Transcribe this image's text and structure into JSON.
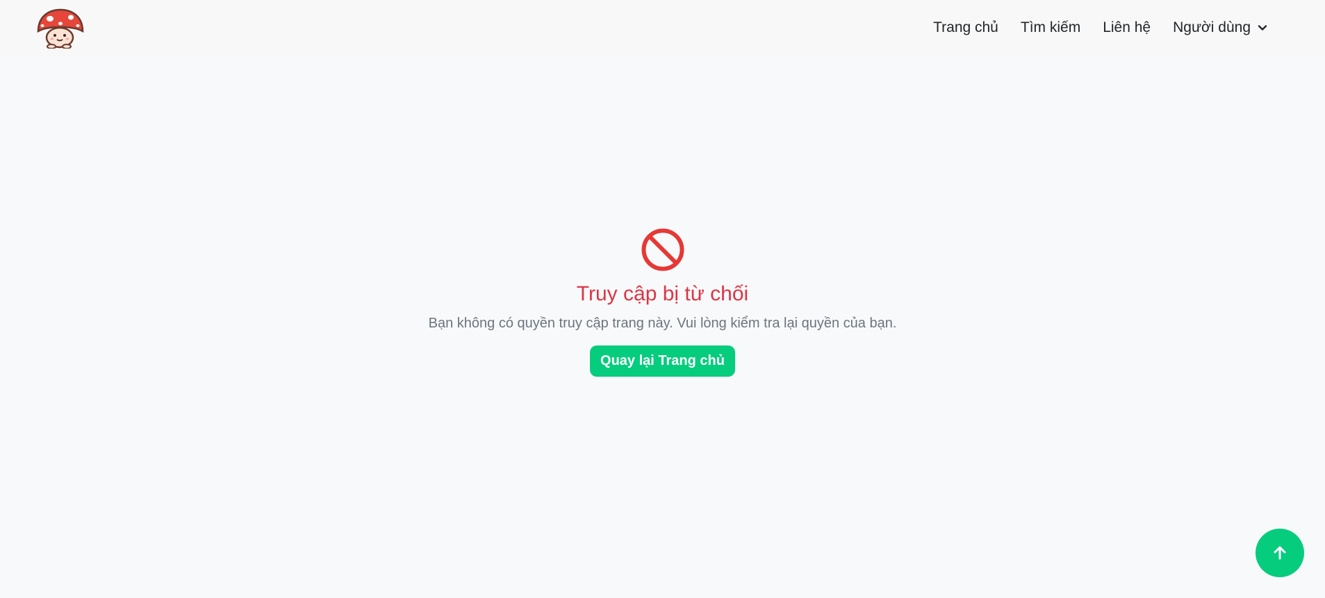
{
  "nav": {
    "links": [
      {
        "label": "Trang chủ"
      },
      {
        "label": "Tìm kiếm"
      },
      {
        "label": "Liên hệ"
      },
      {
        "label": "Người dùng"
      }
    ]
  },
  "error": {
    "icon": "ban-icon",
    "title": "Truy cập bị từ chối",
    "message": "Bạn không có quyền truy cập trang này. Vui lòng kiểm tra lại quyền của bạn.",
    "button_label": "Quay lại Trang chủ"
  },
  "colors": {
    "accent": "#06cc7e",
    "error": "#dc3545",
    "muted": "#6c757d"
  },
  "icons": {
    "logo": "mushroom-logo",
    "dropdown": "chevron-down-icon",
    "scroll_top": "arrow-up-icon"
  }
}
